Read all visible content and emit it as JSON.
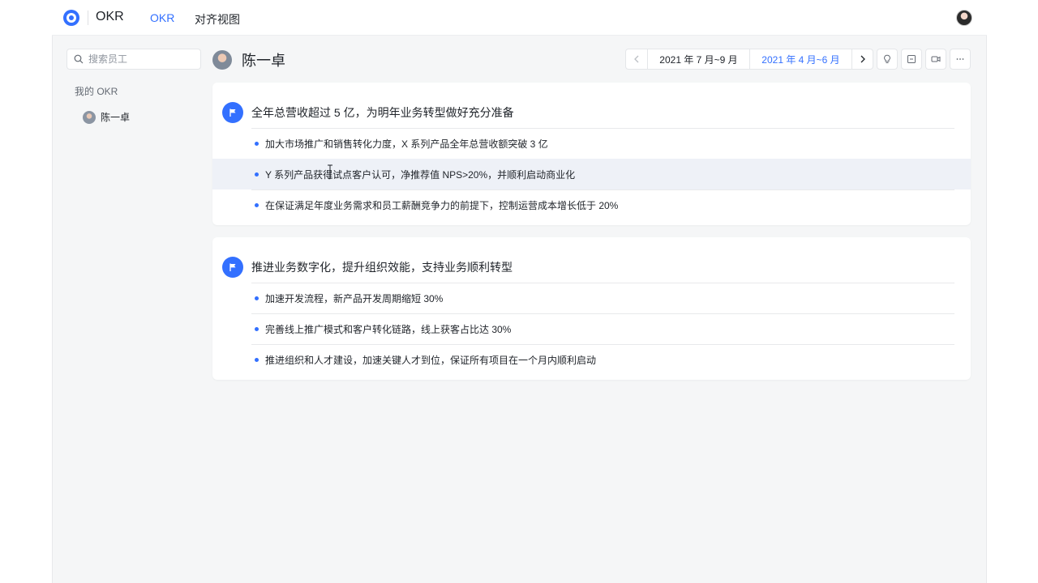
{
  "header": {
    "app_title": "OKR",
    "tabs": [
      {
        "label": "OKR",
        "active": true
      },
      {
        "label": "对齐视图",
        "active": false
      }
    ],
    "accent_color": "#3370ff"
  },
  "sidebar": {
    "search_placeholder": "搜索员工",
    "section_title": "我的 OKR",
    "users": [
      {
        "name": "陈一卓"
      }
    ]
  },
  "person": {
    "name": "陈一卓"
  },
  "toolbar": {
    "periods": [
      {
        "label": "2021 年 7 月~9 月",
        "active": false
      },
      {
        "label": "2021 年 4 月~6 月",
        "active": true
      }
    ],
    "icons": [
      "lightbulb-icon",
      "panel-icon",
      "video-icon",
      "more-icon"
    ]
  },
  "objectives": [
    {
      "title": "全年总营收超过 5 亿，为明年业务转型做好充分准备",
      "key_results": [
        "加大市场推广和销售转化力度，X 系列产品全年总营收额突破 3 亿",
        "Y 系列产品获得试点客户认可，净推荐值 NPS>20%，并顺利启动商业化",
        "在保证满足年度业务需求和员工薪酬竞争力的前提下，控制运营成本增长低于 20%"
      ]
    },
    {
      "title": "推进业务数字化，提升组织效能，支持业务顺利转型",
      "key_results": [
        "加速开发流程，新产品开发周期缩短 30%",
        "完善线上推广模式和客户转化链路，线上获客占比达 30%",
        "推进组织和人才建设，加速关键人才到位，保证所有项目在一个月内顺利启动"
      ]
    }
  ]
}
